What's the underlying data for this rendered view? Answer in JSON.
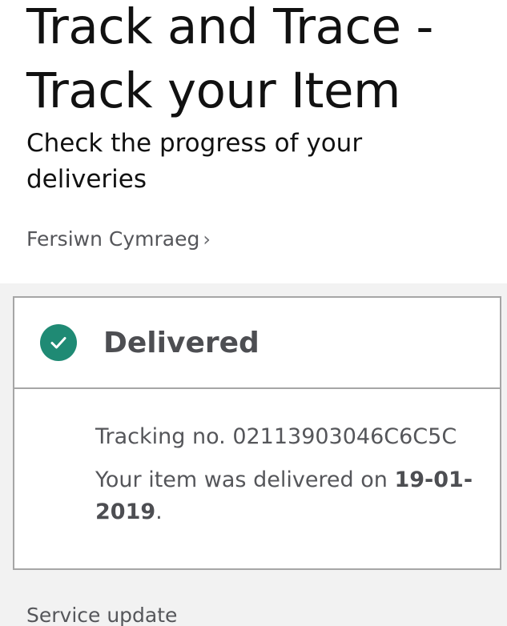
{
  "header": {
    "title": "Track and Trace - Track your Item",
    "subtitle": "Check the progress of your deliveries",
    "language_link": "Fersiwn Cymraeg"
  },
  "card": {
    "status": "Delivered",
    "status_icon": "check-circle-icon",
    "tracking_label": "Tracking no. ",
    "tracking_number": "02113903046C6C5C",
    "delivered_prefix": "Your item was delivered on ",
    "delivered_date": "19-01-2019",
    "delivered_suffix": "."
  },
  "footer": {
    "partial_text": "Service update"
  },
  "colors": {
    "accent": "#1f8a74",
    "border": "#a6a6a6",
    "grey_bg": "#f2f2f2"
  }
}
